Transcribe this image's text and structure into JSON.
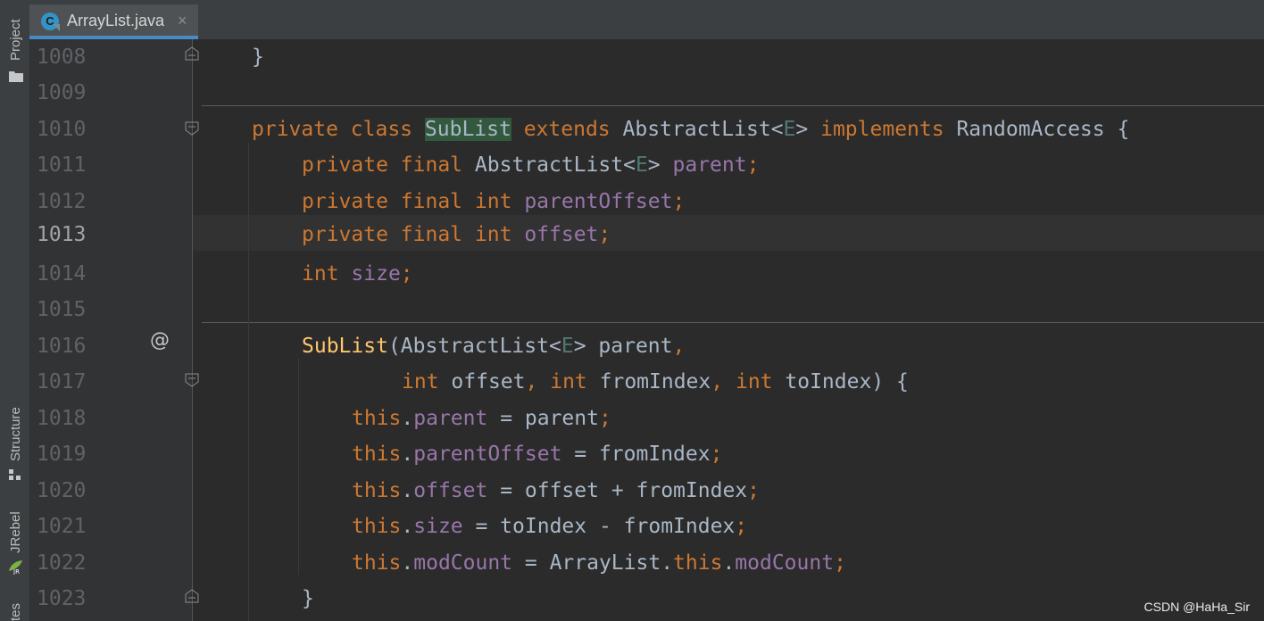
{
  "tool_window_labels": {
    "project": "Project",
    "structure": "Structure",
    "jrebel": "JRebel",
    "bottom_partial": "tes"
  },
  "tab": {
    "icon_letter": "C",
    "title": "ArrayList.java",
    "close": "×"
  },
  "line_numbers": [
    "1008",
    "1009",
    "1010",
    "1011",
    "1012",
    "1013",
    "1014",
    "1015",
    "1016",
    "1017",
    "1018",
    "1019",
    "1020",
    "1021",
    "1022",
    "1023"
  ],
  "current_line": "1013",
  "gutter_marks": {
    "override_at": "@"
  },
  "code": {
    "l1008": {
      "brace": "}"
    },
    "l1010": {
      "private": "private",
      "class": "class",
      "name": "SubList",
      "extends": "extends",
      "super": "AbstractList",
      "lt": "<",
      "tparam": "E",
      "gt": ">",
      "implements": "implements",
      "iface": "RandomAccess",
      "open": "{"
    },
    "l1011": {
      "private": "private",
      "final": "final",
      "type": "AbstractList",
      "lt": "<",
      "tparam": "E",
      "gt": ">",
      "field": "parent",
      "semi": ";"
    },
    "l1012": {
      "private": "private",
      "final": "final",
      "type": "int",
      "field": "parentOffset",
      "semi": ";"
    },
    "l1013": {
      "private": "private",
      "final": "final",
      "type": "int",
      "field": "offset",
      "semi": ";"
    },
    "l1014": {
      "type": "int",
      "field": "size",
      "semi": ";"
    },
    "l1016": {
      "ctor": "SubList",
      "open_paren": "(",
      "type": "AbstractList",
      "lt": "<",
      "tparam": "E",
      "gt": ">",
      "param": "parent",
      "comma": ","
    },
    "l1017": {
      "t1": "int",
      "p1": "offset",
      "c1": ",",
      "t2": "int",
      "p2": "fromIndex",
      "c2": ",",
      "t3": "int",
      "p3": "toIndex",
      "close": ") {"
    },
    "l1018": {
      "this": "this",
      "dot": ".",
      "field": "parent",
      "rest": " = parent",
      "semi": ";"
    },
    "l1019": {
      "this": "this",
      "dot": ".",
      "field": "parentOffset",
      "rest": " = fromIndex",
      "semi": ";"
    },
    "l1020": {
      "this": "this",
      "dot": ".",
      "field": "offset",
      "rest": " = offset + fromIndex",
      "semi": ";"
    },
    "l1021": {
      "this": "this",
      "dot": ".",
      "field": "size",
      "rest": " = toIndex - fromIndex",
      "semi": ";"
    },
    "l1022": {
      "this": "this",
      "dot": ".",
      "field": "modCount",
      "rest1": " = ArrayList.",
      "this2": "this",
      "dot2": ".",
      "field2": "modCount",
      "semi": ";"
    },
    "l1023": {
      "brace": "}"
    }
  },
  "watermark": "CSDN @HaHa_Sir",
  "colors": {
    "background": "#2b2b2b",
    "gutter": "#313335",
    "keyword": "#cc7832",
    "field": "#9876aa",
    "method_decl": "#ffc66d",
    "type_param": "#507874",
    "identifier_highlight": "#32593d",
    "tab_accent": "#4a88c7"
  }
}
